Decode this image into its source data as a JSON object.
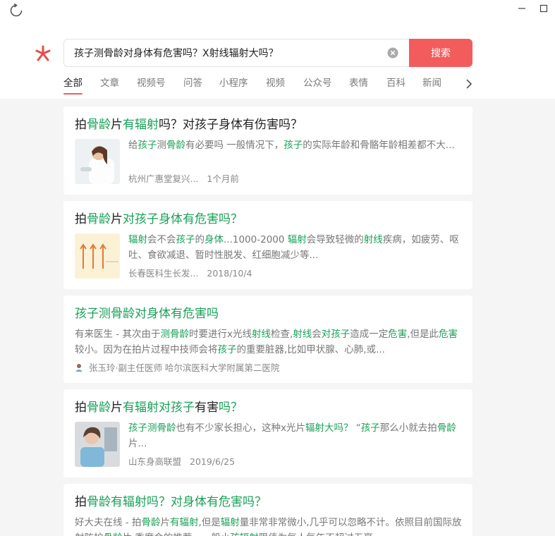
{
  "search": {
    "query": "孩子测骨龄对身体有危害吗？X射线辐射大吗？",
    "button_label": "搜索"
  },
  "tabs": [
    {
      "label": "全部",
      "active": true
    },
    {
      "label": "文章",
      "active": false
    },
    {
      "label": "视频号",
      "active": false
    },
    {
      "label": "问答",
      "active": false
    },
    {
      "label": "小程序",
      "active": false
    },
    {
      "label": "视频",
      "active": false
    },
    {
      "label": "公众号",
      "active": false
    },
    {
      "label": "表情",
      "active": false
    },
    {
      "label": "百科",
      "active": false
    },
    {
      "label": "新闻",
      "active": false
    }
  ],
  "results": [
    {
      "title": [
        [
          "拍",
          false
        ],
        [
          "骨龄",
          true
        ],
        [
          "片",
          false
        ],
        [
          "有辐射",
          true
        ],
        [
          "吗？对孩子身体有伤害吗？",
          false
        ]
      ],
      "snippet": [
        [
          "给",
          false
        ],
        [
          "孩子",
          true
        ],
        [
          "测",
          false
        ],
        [
          "骨龄",
          true
        ],
        [
          "有",
          false
        ],
        [
          "必要吗 一般情况下，",
          false
        ],
        [
          "孩子",
          true
        ],
        [
          "的实际年龄和骨骼年龄相差都不大...",
          false
        ]
      ],
      "source": "杭州广惠堂复兴...",
      "date": "1个月前"
    },
    {
      "title": [
        [
          "拍",
          false
        ],
        [
          "骨龄",
          true
        ],
        [
          "片",
          false
        ],
        [
          "对孩子身体有危害吗？",
          true
        ]
      ],
      "snippet": [
        [
          "辐射",
          true
        ],
        [
          "会不会",
          false
        ],
        [
          "孩子",
          true
        ],
        [
          "的",
          false
        ],
        [
          "身体",
          true
        ],
        [
          "...1000-2000 ",
          false
        ],
        [
          "辐射",
          true
        ],
        [
          "会导致轻微的",
          false
        ],
        [
          "射线",
          true
        ],
        [
          "疾病，如疲劳、呕吐、食欲减退、暂时性脱发、红细胞减少等...",
          false
        ]
      ],
      "source": "长春医科生长发...",
      "date": "2018/10/4"
    },
    {
      "title": [
        [
          "孩子测骨龄对身体有危害吗",
          true
        ]
      ],
      "snippet": [
        [
          "有来医生 - 其次由于",
          false
        ],
        [
          "测骨龄",
          true
        ],
        [
          "时要进行x光线",
          false
        ],
        [
          "射线",
          true
        ],
        [
          "检查,",
          false
        ],
        [
          "射线",
          true
        ],
        [
          "会",
          false
        ],
        [
          "对孩子",
          true
        ],
        [
          "造成一定",
          false
        ],
        [
          "危害",
          true
        ],
        [
          ",但是此",
          false
        ],
        [
          "危害",
          true
        ],
        [
          "较小。因为在拍片过程中技师会将",
          false
        ],
        [
          "孩子",
          true
        ],
        [
          "的重要脏器,比如甲状腺、心肺,或...",
          false
        ]
      ],
      "author": "张玉玲·副主任医师 哈尔滨医科大学附属第二医院"
    },
    {
      "title": [
        [
          "拍",
          false
        ],
        [
          "骨龄",
          true
        ],
        [
          "片",
          false
        ],
        [
          "有辐射对孩子",
          true
        ],
        [
          "有害",
          false
        ],
        [
          "吗？",
          true
        ]
      ],
      "snippet": [
        [
          "孩子测骨龄",
          true
        ],
        [
          "也有不少家长担心，这种x光片",
          false
        ],
        [
          "辐射大吗？",
          true
        ],
        [
          " “",
          false
        ],
        [
          "孩子",
          true
        ],
        [
          "那么小就去拍",
          false
        ],
        [
          "骨龄",
          true
        ],
        [
          "片...",
          false
        ]
      ],
      "source": "山东身高联盟",
      "date": "2019/6/25"
    },
    {
      "title": [
        [
          "拍",
          false
        ],
        [
          "骨龄有辐射吗？对身体有危害吗？",
          true
        ]
      ],
      "snippet": [
        [
          "好大夫在线 - 拍",
          false
        ],
        [
          "骨龄",
          true
        ],
        [
          "片",
          false
        ],
        [
          "有辐射",
          true
        ],
        [
          ",但是",
          false
        ],
        [
          "辐射",
          true
        ],
        [
          "量非常非常微小,几乎可以忽略不计。依照目前国际放射防护",
          false
        ],
        [
          "骨龄",
          true
        ],
        [
          "片,季度会的推荐，一般小",
          false
        ],
        [
          "孩辐射",
          true
        ],
        [
          "限值为每人每年不超过五毫",
          false
        ]
      ]
    }
  ]
}
